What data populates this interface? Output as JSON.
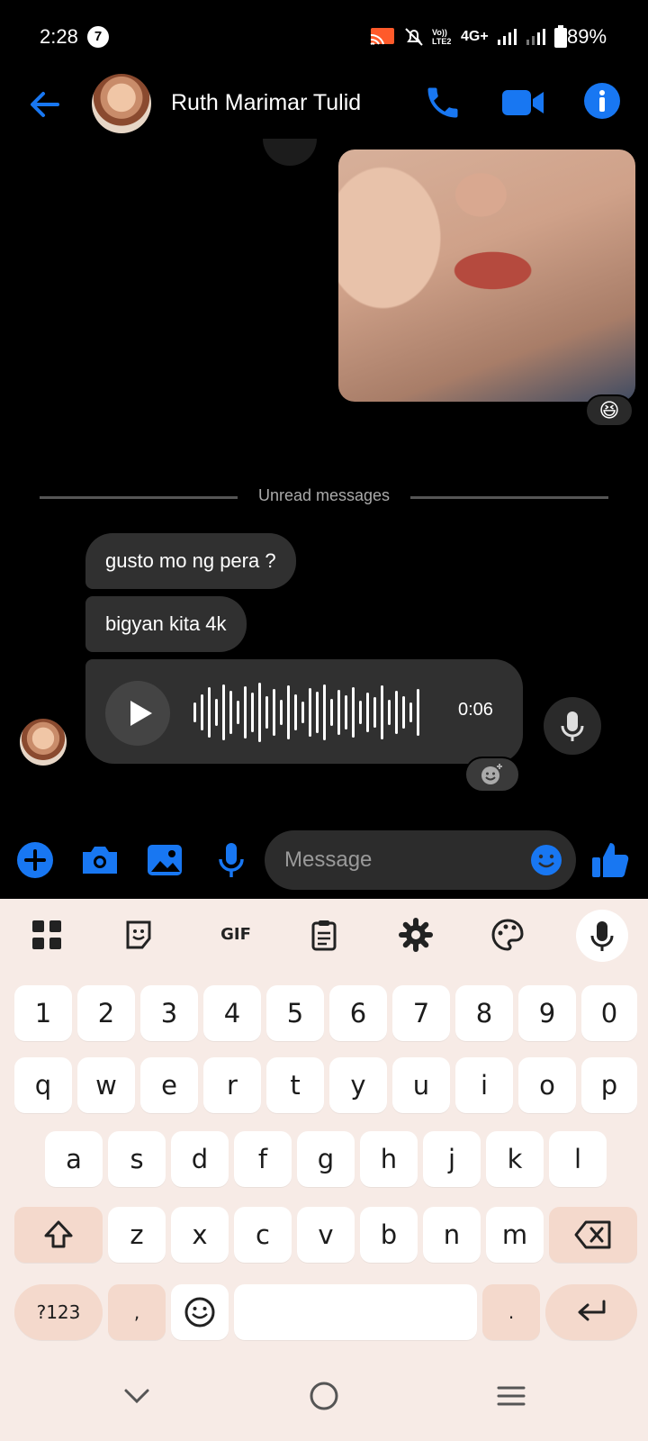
{
  "status_bar": {
    "time": "2:28",
    "notification_count": "7",
    "lte_label": "Vo)) LTE2",
    "network": "4G+",
    "battery": "89%"
  },
  "header": {
    "contact_name": "Ruth Marimar Tulid"
  },
  "chat": {
    "photo_reaction": "😆",
    "unread_label": "Unread messages",
    "messages": [
      {
        "text": "gusto mo ng pera ?"
      },
      {
        "text": "bigyan kita 4k"
      }
    ],
    "voice_message": {
      "duration": "0:06"
    }
  },
  "composer": {
    "placeholder": "Message"
  },
  "keyboard": {
    "toolbar": {
      "gif_label": "GIF"
    },
    "number_row": [
      "1",
      "2",
      "3",
      "4",
      "5",
      "6",
      "7",
      "8",
      "9",
      "0"
    ],
    "row1": [
      "q",
      "w",
      "e",
      "r",
      "t",
      "y",
      "u",
      "i",
      "o",
      "p"
    ],
    "row2": [
      "a",
      "s",
      "d",
      "f",
      "g",
      "h",
      "j",
      "k",
      "l"
    ],
    "row3": [
      "z",
      "x",
      "c",
      "v",
      "b",
      "n",
      "m"
    ],
    "symbols_label": "?123",
    "comma_label": ",",
    "period_label": "."
  },
  "colors": {
    "accent": "#1877f2",
    "background": "#000000",
    "bubble": "#303030",
    "keyboard_bg": "#f7ebe6",
    "mod_key": "#f4d9cc"
  }
}
